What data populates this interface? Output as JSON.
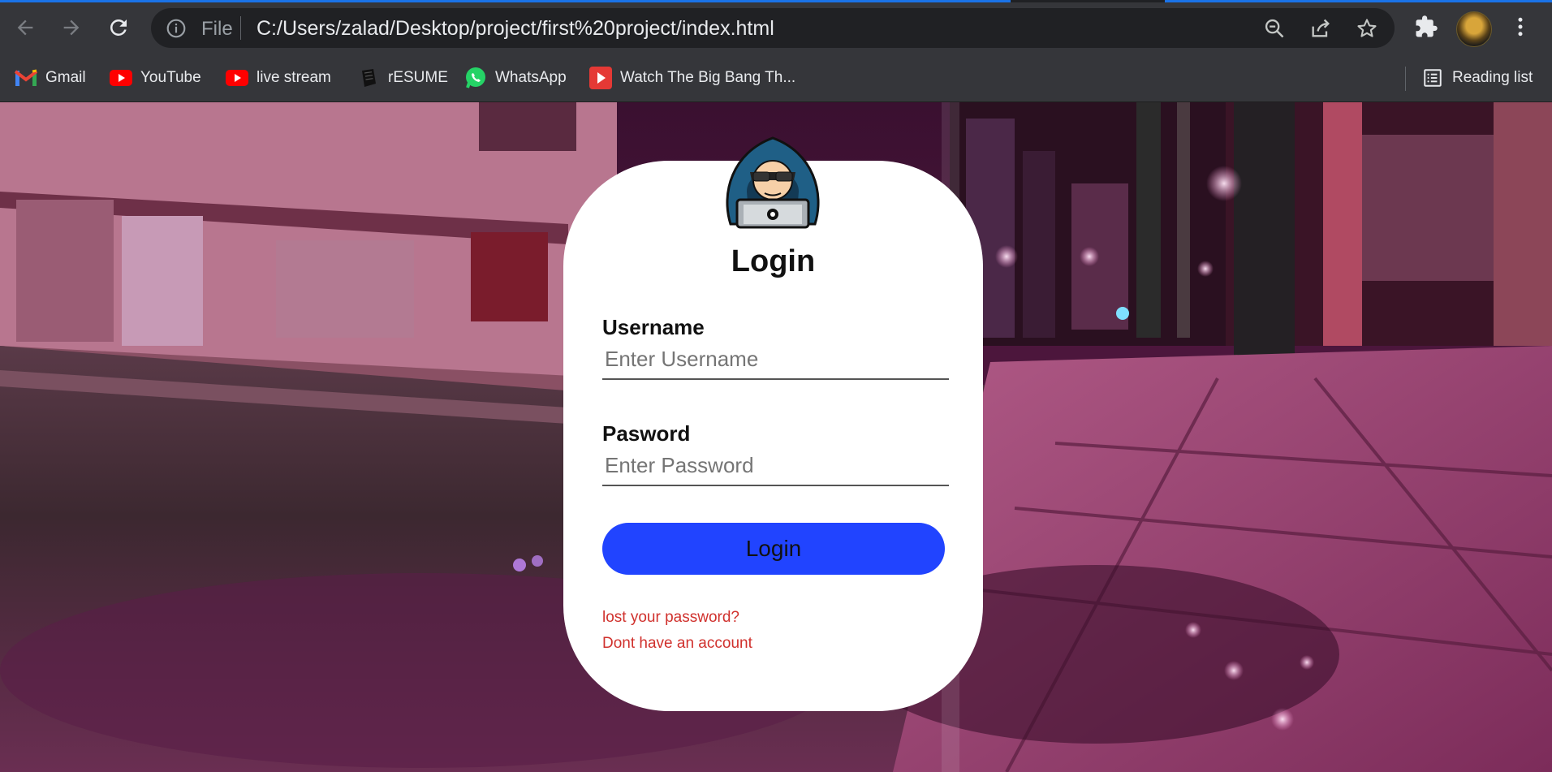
{
  "browser": {
    "omnibox": {
      "scheme_label": "File",
      "url": "C:/Users/zalad/Desktop/project/first%20project/index.html"
    },
    "bookmarks": [
      {
        "label": "Gmail",
        "icon": "gmail-icon"
      },
      {
        "label": "YouTube",
        "icon": "youtube-icon"
      },
      {
        "label": "live stream",
        "icon": "youtube-icon"
      },
      {
        "label": "rESUME",
        "icon": "resume-icon"
      },
      {
        "label": "WhatsApp",
        "icon": "whatsapp-icon"
      },
      {
        "label": "Watch The Big Bang Th...",
        "icon": "play-icon"
      }
    ],
    "reading_list_label": "Reading list"
  },
  "login": {
    "title": "Login",
    "username_label": "Username",
    "username_placeholder": "Enter Username",
    "password_label": "Pasword",
    "password_placeholder": "Enter Password",
    "button_label": "Login",
    "lost_password_link": "lost your password?",
    "no_account_link": "Dont have an account"
  },
  "colors": {
    "accent_button": "#2144ff",
    "link_red": "#d0312d",
    "toolbar_bg": "#35363a",
    "omnibox_bg": "#202124"
  }
}
